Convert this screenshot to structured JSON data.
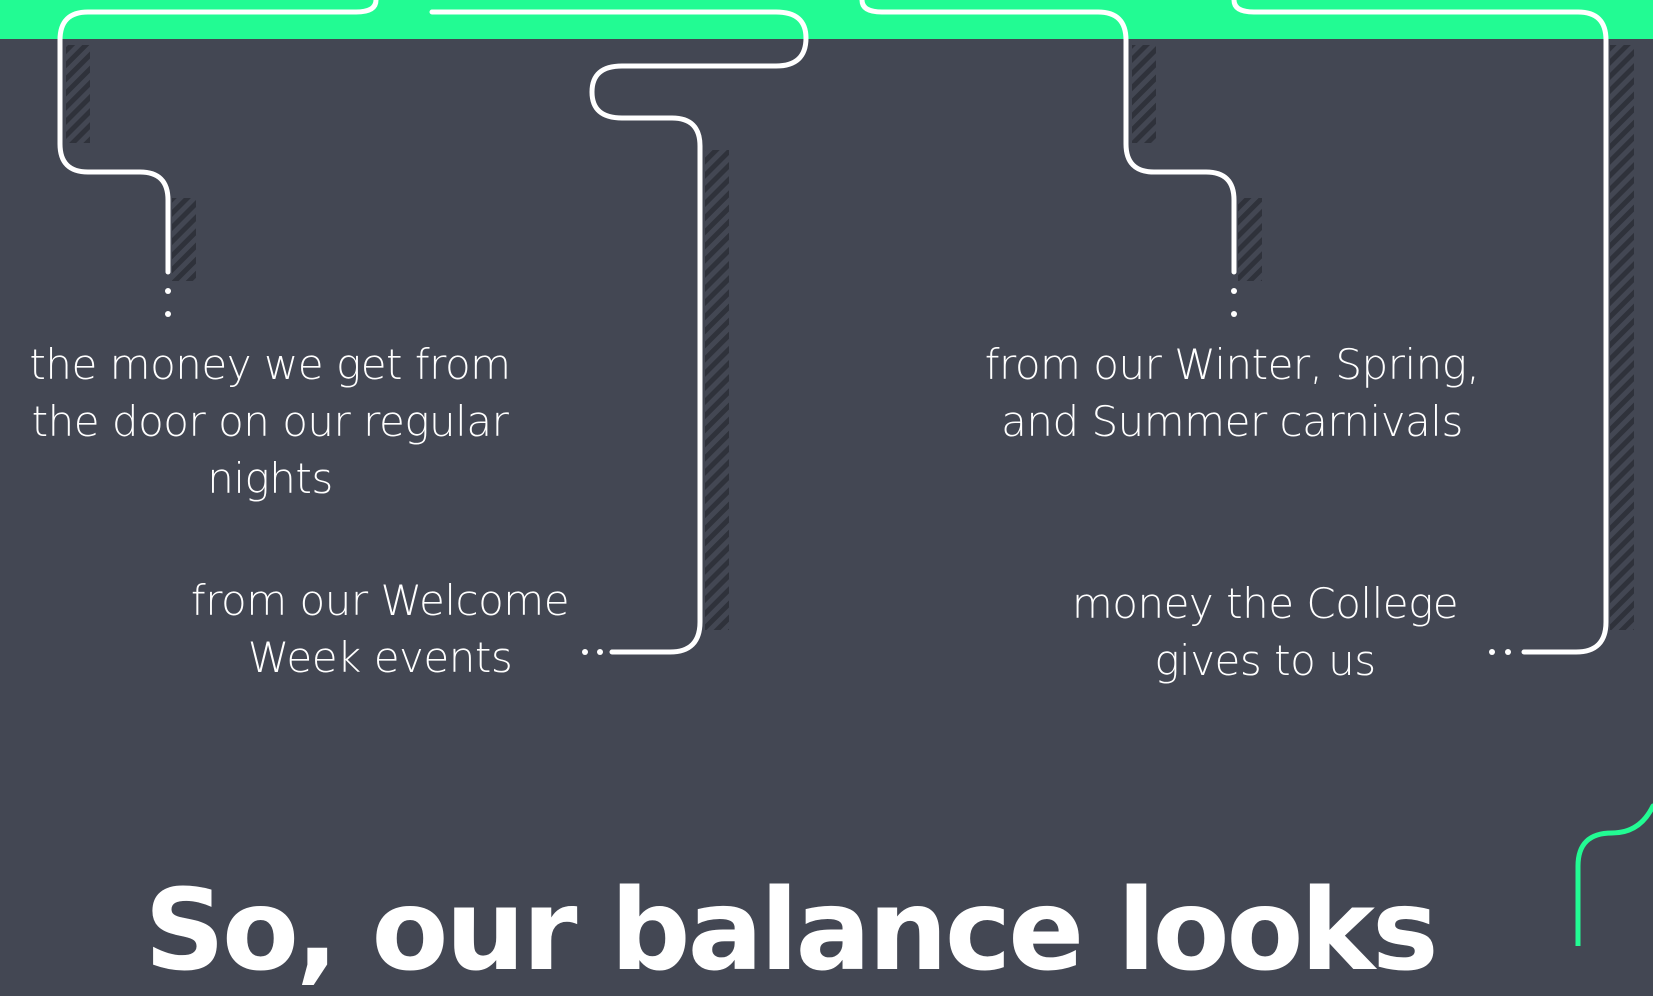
{
  "colors": {
    "background": "#434753",
    "accent_green": "#22fb93",
    "line_white": "#ffffff",
    "hatch_dark": "#2f323b"
  },
  "captions": {
    "door": "the money we get from the door on our regular nights",
    "welcome": "from our Welcome Week events",
    "carnival": "from our Winter, Spring, and Summer carnivals",
    "college": "money the College gives to us"
  },
  "headline": "So, our balance looks"
}
